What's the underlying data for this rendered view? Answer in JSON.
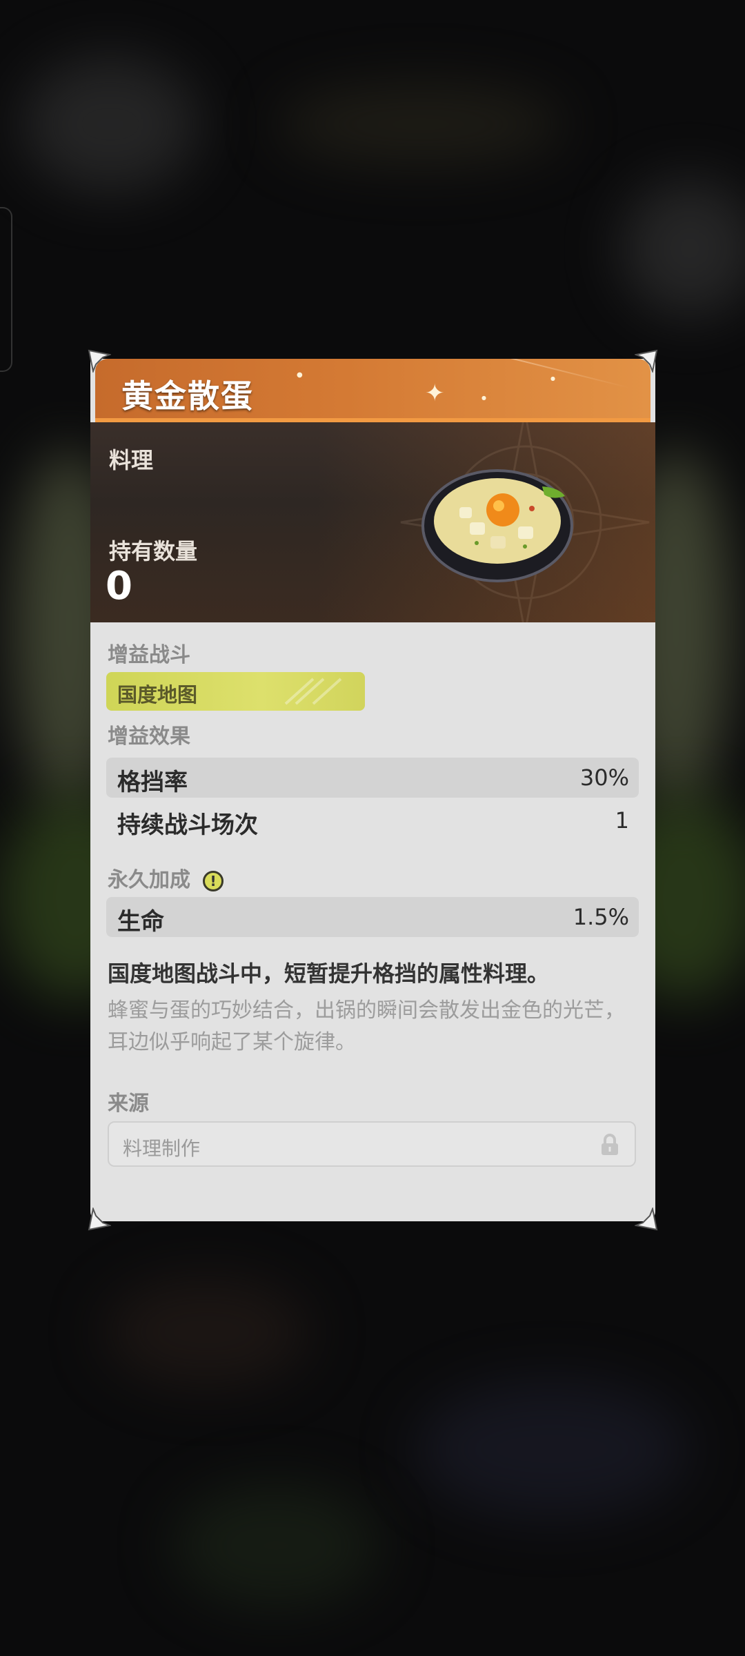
{
  "item": {
    "title": "黄金散蛋",
    "category": "料理",
    "hold_label": "持有数量",
    "hold_value": "0",
    "image_icon": "dish-icon"
  },
  "buff_battle": {
    "label": "增益战斗",
    "tag": "国度地图"
  },
  "buff_effects": {
    "label": "增益效果",
    "rows": [
      {
        "key": "格挡率",
        "value": "30%"
      },
      {
        "key": "持续战斗场次",
        "value": "1"
      }
    ]
  },
  "permanent": {
    "label": "永久加成",
    "info_icon": "exclamation-icon",
    "rows": [
      {
        "key": "生命",
        "value": "1.5%"
      }
    ]
  },
  "description": {
    "main": "国度地图战斗中，短暂提升格挡的属性料理。",
    "flavor": "蜂蜜与蛋的巧妙结合，出锅的瞬间会散发出金色的光芒，耳边似乎响起了某个旋律。"
  },
  "source": {
    "label": "来源",
    "value": "料理制作",
    "icon": "lock-icon"
  },
  "colors": {
    "title_band": "#d47a34",
    "tag": "#dde06c",
    "card_body": "#e2e2e2"
  }
}
